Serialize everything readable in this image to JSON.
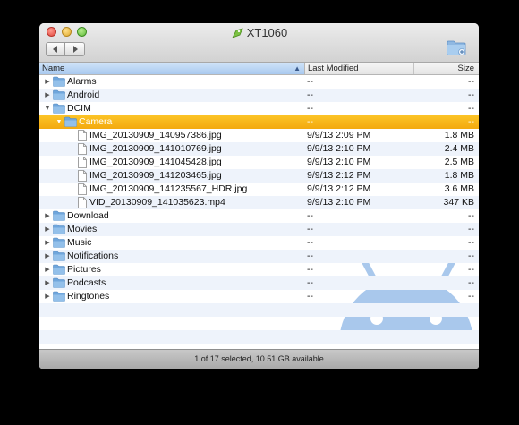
{
  "window": {
    "title": "XT1060"
  },
  "toolbar": {
    "back_icon": "chevron-left-icon",
    "forward_icon": "chevron-right-icon",
    "new_folder_icon": "new-folder-icon"
  },
  "columns": {
    "name": "Name",
    "modified": "Last Modified",
    "size": "Size"
  },
  "rows": [
    {
      "name": "Alarms",
      "modified": "--",
      "size": "--",
      "type": "folder",
      "depth": 0,
      "expanded": false
    },
    {
      "name": "Android",
      "modified": "--",
      "size": "--",
      "type": "folder",
      "depth": 0,
      "expanded": false
    },
    {
      "name": "DCIM",
      "modified": "--",
      "size": "--",
      "type": "folder",
      "depth": 0,
      "expanded": true
    },
    {
      "name": "Camera",
      "modified": "--",
      "size": "--",
      "type": "folder",
      "depth": 1,
      "expanded": true,
      "selected": true
    },
    {
      "name": "IMG_20130909_140957386.jpg",
      "modified": "9/9/13 2:09 PM",
      "size": "1.8 MB",
      "type": "file",
      "depth": 2
    },
    {
      "name": "IMG_20130909_141010769.jpg",
      "modified": "9/9/13 2:10 PM",
      "size": "2.4 MB",
      "type": "file",
      "depth": 2
    },
    {
      "name": "IMG_20130909_141045428.jpg",
      "modified": "9/9/13 2:10 PM",
      "size": "2.5 MB",
      "type": "file",
      "depth": 2
    },
    {
      "name": "IMG_20130909_141203465.jpg",
      "modified": "9/9/13 2:12 PM",
      "size": "1.8 MB",
      "type": "file",
      "depth": 2
    },
    {
      "name": "IMG_20130909_141235567_HDR.jpg",
      "modified": "9/9/13 2:12 PM",
      "size": "3.6 MB",
      "type": "file",
      "depth": 2
    },
    {
      "name": "VID_20130909_141035623.mp4",
      "modified": "9/9/13 2:10 PM",
      "size": "347 KB",
      "type": "file",
      "depth": 2
    },
    {
      "name": "Download",
      "modified": "--",
      "size": "--",
      "type": "folder",
      "depth": 0,
      "expanded": false
    },
    {
      "name": "Movies",
      "modified": "--",
      "size": "--",
      "type": "folder",
      "depth": 0,
      "expanded": false
    },
    {
      "name": "Music",
      "modified": "--",
      "size": "--",
      "type": "folder",
      "depth": 0,
      "expanded": false
    },
    {
      "name": "Notifications",
      "modified": "--",
      "size": "--",
      "type": "folder",
      "depth": 0,
      "expanded": false
    },
    {
      "name": "Pictures",
      "modified": "--",
      "size": "--",
      "type": "folder",
      "depth": 0,
      "expanded": false
    },
    {
      "name": "Podcasts",
      "modified": "--",
      "size": "--",
      "type": "folder",
      "depth": 0,
      "expanded": false
    },
    {
      "name": "Ringtones",
      "modified": "--",
      "size": "--",
      "type": "folder",
      "depth": 0,
      "expanded": false
    }
  ],
  "status": {
    "text": "1 of 17 selected, 10.51 GB available"
  },
  "colors": {
    "selection": "#f3a90f",
    "header_active": "#a9c9ef",
    "folder": "#6fa6dc",
    "watermark": "#a9c8ec"
  }
}
